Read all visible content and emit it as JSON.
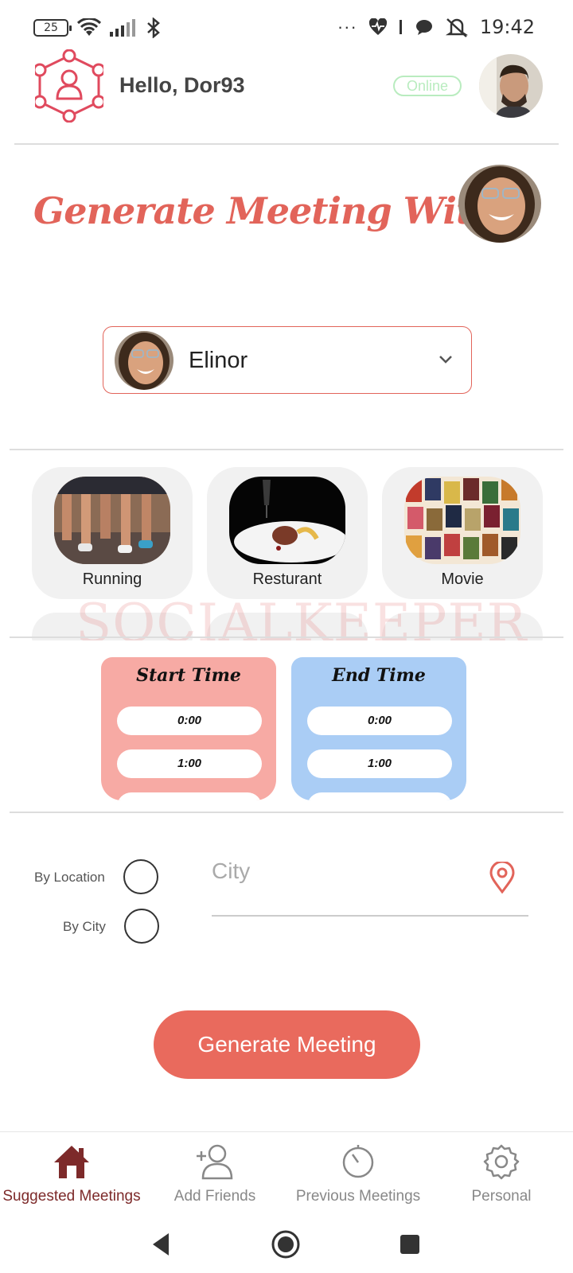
{
  "status_bar": {
    "battery": "25",
    "time": "19:42",
    "dots": "···"
  },
  "header": {
    "greeting": "Hello, Dor93",
    "status_badge": "Online"
  },
  "generate_section": {
    "title": "Generate Meeting With",
    "selected_friend": "Elinor"
  },
  "activities": [
    {
      "label": "Running"
    },
    {
      "label": "Resturant"
    },
    {
      "label": "Movie"
    }
  ],
  "watermark": "SOCIALKEEPER",
  "time_pickers": {
    "start": {
      "title": "Start Time",
      "options": [
        "0:00",
        "1:00"
      ]
    },
    "end": {
      "title": "End Time",
      "options": [
        "0:00",
        "1:00"
      ]
    }
  },
  "location": {
    "by_location_label": "By Location",
    "by_city_label": "By City",
    "city_placeholder": "City"
  },
  "generate_button": "Generate Meeting",
  "bottom_nav": [
    {
      "label": "Suggested Meetings",
      "icon": "home-icon",
      "active": true
    },
    {
      "label": "Add Friends",
      "icon": "add-user-icon",
      "active": false
    },
    {
      "label": "Previous Meetings",
      "icon": "timer-icon",
      "active": false
    },
    {
      "label": "Personal",
      "icon": "gear-icon",
      "active": false
    }
  ],
  "colors": {
    "accent": "#e2645a",
    "button": "#e96a5d",
    "start_card": "#f7aaa4",
    "end_card": "#aacdf5",
    "online": "#b9ecbf",
    "active_nav": "#7d2a2a"
  }
}
